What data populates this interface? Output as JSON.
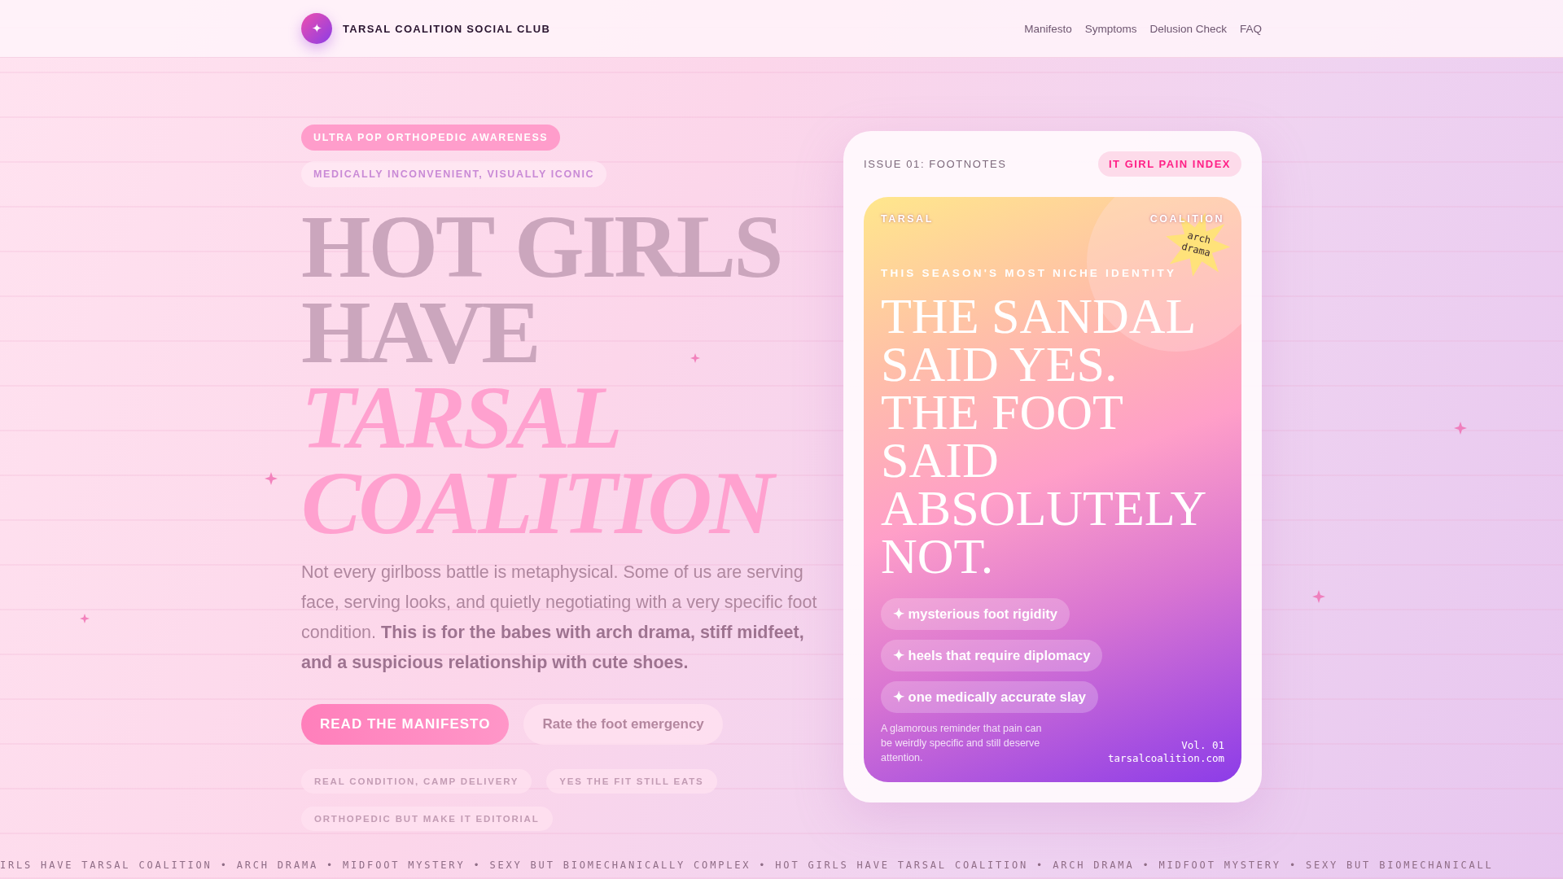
{
  "nav": {
    "logo_glyph": "✦",
    "brand": "TARSAL COALITION SOCIAL CLUB",
    "links": [
      "Manifesto",
      "Symptoms",
      "Delusion Check",
      "FAQ"
    ]
  },
  "hero": {
    "tags": [
      {
        "text": "ULTRA POP ORTHOPEDIC AWARENESS",
        "kind": "filled"
      },
      {
        "text": "MEDICALLY INCONVENIENT, VISUALLY ICONIC",
        "kind": "soft"
      }
    ],
    "title_lines": [
      {
        "text": "HOT GIRLS",
        "kind": "plain"
      },
      {
        "text": "HAVE",
        "kind": "plain"
      },
      {
        "text": "TARSAL",
        "kind": "accent"
      },
      {
        "text": "COALITION",
        "kind": "accent"
      }
    ],
    "intro": "Not every girlboss battle is metaphysical. Some of us are serving face, serving looks, and quietly negotiating with a very specific foot condition. **This is for the babes with arch drama, stiff midfeet, and a suspicious relationship with cute shoes.**",
    "buttons": [
      {
        "label": "READ THE MANIFESTO",
        "kind": "primary"
      },
      {
        "label": "Rate the foot emergency",
        "kind": "secondary"
      }
    ],
    "chips": [
      "REAL CONDITION, CAMP DELIVERY",
      "YES THE FIT STILL EATS",
      "ORTHOPEDIC BUT MAKE IT EDITORIAL"
    ]
  },
  "card": {
    "issue": "ISSUE 01: FOOTNOTES",
    "badge": "IT GIRL PAIN INDEX",
    "cover": {
      "left_label": "TARSAL",
      "right_label": "COALITION",
      "sticker": "arch drama",
      "kicker": "THIS SEASON'S MOST NICHE IDENTITY",
      "headline_lines": [
        "THE SANDAL",
        "SAID YES.",
        "THE FOOT",
        "SAID",
        "ABSOLUTELY",
        "NOT."
      ],
      "features": [
        "✦ mysterious foot rigidity",
        "✦ heels that require diplomacy",
        "✦ one medically accurate slay"
      ],
      "caption": "A glamorous reminder that pain can be weirdly specific and still deserve attention.",
      "volume": "Vol. 01",
      "site": "tarsalcoalition.com"
    }
  },
  "ticker": "IRLS HAVE TARSAL COALITION • ARCH DRAMA • MIDFOOT MYSTERY • SEXY BUT BIOMECHANICALLY COMPLEX • HOT GIRLS HAVE TARSAL COALITION • ARCH DRAMA • MIDFOOT MYSTERY • SEXY BUT BIOMECHANICALL"
}
